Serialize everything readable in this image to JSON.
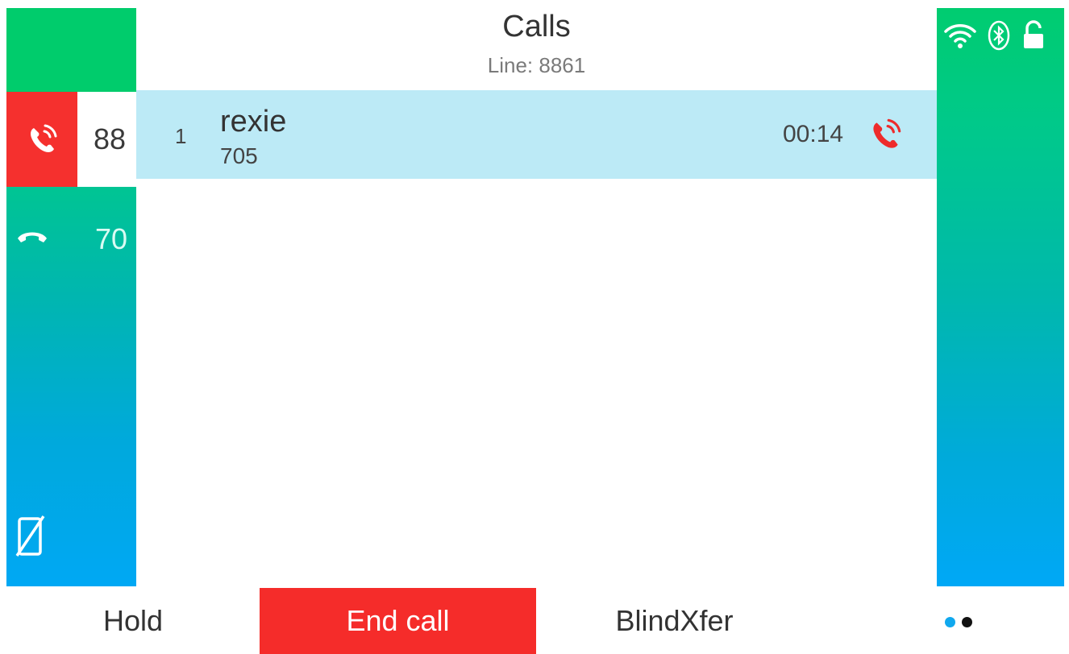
{
  "header": {
    "title": "Calls",
    "subtitle": "Line: 8861"
  },
  "lines": [
    {
      "label": "88",
      "icon": "active-call-icon",
      "state": "active"
    },
    {
      "label": "70",
      "icon": "handset-icon",
      "state": "idle"
    }
  ],
  "call": {
    "index": "1",
    "name": "rexie",
    "number": "705",
    "duration": "00:14",
    "status_icon": "active-call-icon"
  },
  "status_bar": {
    "icons": [
      "wifi-icon",
      "bluetooth-icon",
      "unlocked-icon"
    ]
  },
  "left_panel": {
    "bottom_icon": "no-mobile-icon"
  },
  "softkeys": {
    "hold": "Hold",
    "end_call": "End call",
    "blind_transfer": "BlindXfer"
  },
  "pager": {
    "pages": 2,
    "current": 1
  },
  "colors": {
    "accent_red": "#f52c2a",
    "selection_blue": "#bceaf6",
    "panel_green": "#00cc6c",
    "panel_blue": "#00a8f4"
  }
}
